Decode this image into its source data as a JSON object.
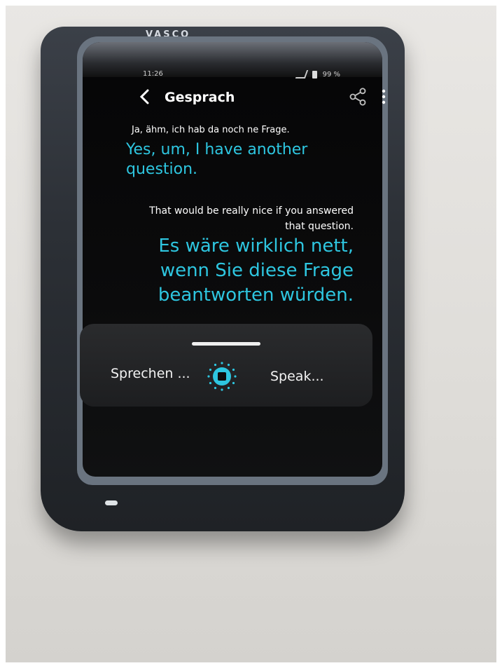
{
  "device": {
    "brand": "VASCO"
  },
  "status_bar": {
    "time": "11:26",
    "battery": "99 %"
  },
  "app_bar": {
    "title": "Gesprach"
  },
  "conversation": [
    {
      "source": "Ja, ähm, ich hab da noch ne Frage.",
      "translation": "Yes, um, I have another question."
    },
    {
      "source": "That would be really nice if you answered that question.",
      "translation": "Es wäre wirklich nett, wenn Sie diese Frage beantworten würden."
    }
  ],
  "speak_panel": {
    "left_label": "Sprechen ...",
    "right_label": "Speak..."
  },
  "colors": {
    "accent": "#2ec6e0",
    "screen": "#0b0b0c"
  }
}
